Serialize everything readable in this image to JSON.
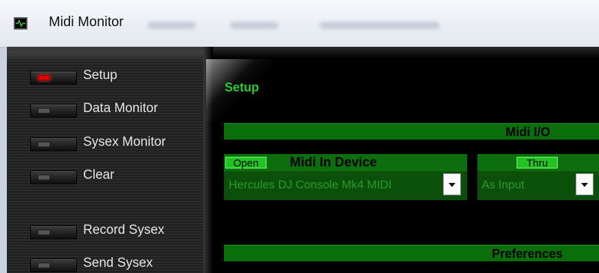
{
  "window": {
    "title": "Midi Monitor"
  },
  "sidebar": {
    "items": [
      {
        "label": "Setup",
        "active": true
      },
      {
        "label": "Data Monitor",
        "active": false
      },
      {
        "label": "Sysex Monitor",
        "active": false
      },
      {
        "label": "Clear",
        "active": false
      },
      {
        "label": "Record Sysex",
        "active": false
      },
      {
        "label": "Send Sysex",
        "active": false
      }
    ]
  },
  "main": {
    "section_title": "Setup",
    "midi_io_header": "Midi I/O",
    "midi_in": {
      "open_button": "Open",
      "title": "Midi In Device",
      "selected": "Hercules DJ Console Mk4 MIDI"
    },
    "thru": {
      "button": "Thru",
      "selected": "As Input"
    },
    "preferences_header": "Preferences"
  },
  "colors": {
    "accent_green": "#0c6e0c",
    "text_green": "#2ccc2c",
    "led_on": "#e00000"
  },
  "icons": {
    "app": "oscilloscope-icon",
    "dropdown": "chevron-down-icon"
  }
}
